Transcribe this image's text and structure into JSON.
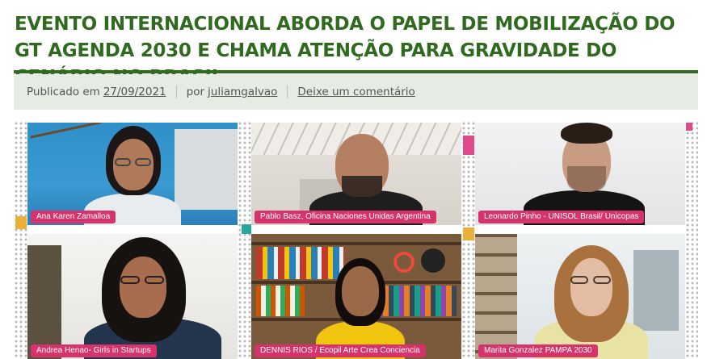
{
  "article": {
    "title": "EVENTO INTERNACIONAL ABORDA O PAPEL DE MOBILIZAÇÃO DO GT AGENDA 2030 E CHAMA ATENÇÃO PARA GRAVIDADE DO CENÁRIO NO BRASIL",
    "meta": {
      "published_prefix": "Publicado em",
      "date": "27/09/2021",
      "by_prefix": "por",
      "author": "juliamgalvao",
      "comment_link": "Deixe um comentário"
    }
  },
  "video_call": {
    "participants": [
      {
        "name": "Ana Karen Zamalloa"
      },
      {
        "name": "Pablo Basz, Oficina Naciones Unidas Argentina"
      },
      {
        "name": "Leonardo Pinho - UNISOL Brasil/ Unicopas"
      },
      {
        "name": "Andrea Henao- Girls in Startups"
      },
      {
        "name": "DENNIS RIOS / Ecopil Arte Crea Conciencia"
      },
      {
        "name": "Marita Gonzalez PAMPA 2030"
      }
    ]
  },
  "colors": {
    "title_green": "#2f6a1f",
    "meta_bg": "#e6ebe4",
    "name_tag": "#d6336c"
  }
}
